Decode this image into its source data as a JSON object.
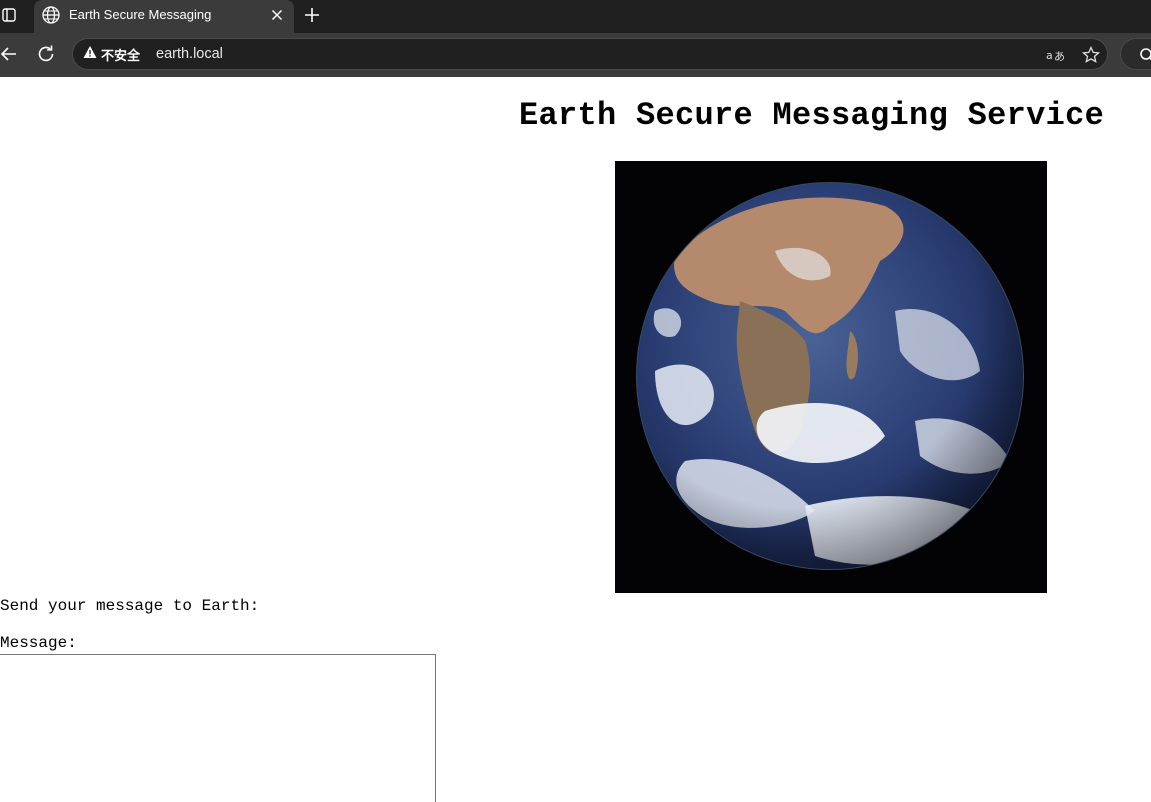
{
  "browser": {
    "tab": {
      "title": "Earth Secure Messaging"
    },
    "address_bar": {
      "security_label": "不安全",
      "url": "earth.local"
    },
    "icons": {
      "tab_panel": "tab-panel-icon",
      "favicon": "globe-icon",
      "close": "close-icon",
      "new_tab": "plus-icon",
      "back": "arrow-left-icon",
      "reload": "reload-icon",
      "warning": "warning-triangle-icon",
      "translate": "translate-icon",
      "favorite": "star-icon",
      "search": "search-icon"
    }
  },
  "page": {
    "title": "Earth Secure Messaging Service",
    "image": {
      "subject": "earth-globe"
    },
    "prompt": "Send your message to Earth:",
    "message_label": "Message:",
    "message_value": ""
  }
}
